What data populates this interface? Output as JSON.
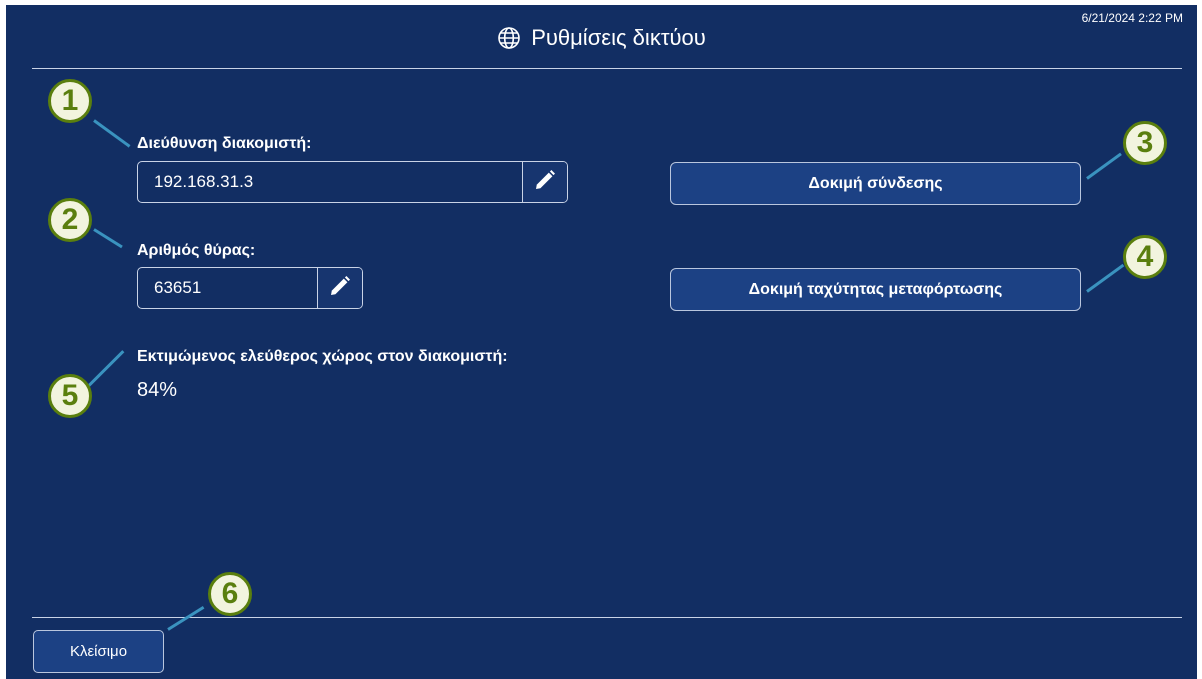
{
  "header": {
    "timestamp": "6/21/2024 2:22 PM",
    "title": "Ρυθμίσεις δικτύου",
    "icon": "globe-icon"
  },
  "server": {
    "label": "Διεύθυνση διακομιστή:",
    "value": "192.168.31.3",
    "edit_icon": "pencil-icon"
  },
  "port": {
    "label": "Αριθμός θύρας:",
    "value": "63651",
    "edit_icon": "pencil-icon"
  },
  "buttons": {
    "test_connection": "Δοκιμή σύνδεσης",
    "test_upload_speed": "Δοκιμή ταχύτητας μεταφόρτωσης",
    "close": "Κλείσιμο"
  },
  "free_space": {
    "label": "Εκτιμώμενος ελεύθερος χώρος στον διακομιστή:",
    "value": "84%"
  },
  "callouts": [
    "1",
    "2",
    "3",
    "4",
    "5",
    "6"
  ],
  "colors": {
    "panel_background": "#122e63",
    "button_background": "#1c4184",
    "callout_border": "#5a7f0e",
    "callout_fill": "#f2f4de",
    "callout_line": "#3a93bf"
  }
}
